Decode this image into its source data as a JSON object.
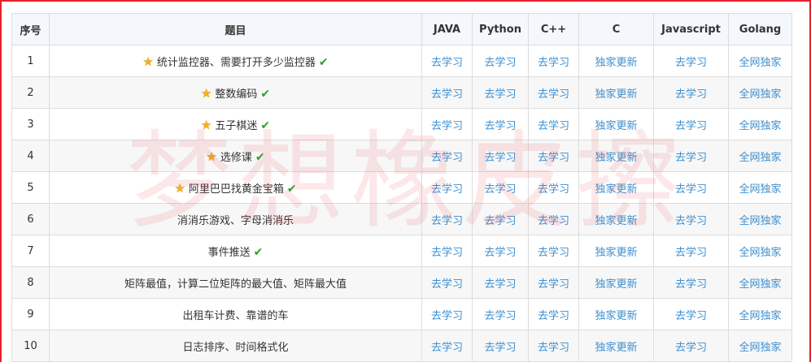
{
  "columns": {
    "index": "序号",
    "title": "题目",
    "java": "JAVA",
    "python": "Python",
    "cpp": "C++",
    "c": "C",
    "javascript": "Javascript",
    "golang": "Golang"
  },
  "icons": {
    "star": "star-icon",
    "check": "check-icon"
  },
  "colors": {
    "link": "#3d8fcf",
    "star": "#f2b01e",
    "check": "#2f9e28",
    "border": "#e8202a",
    "watermark": "#e83c46"
  },
  "watermark": "梦想橡皮擦",
  "rows": [
    {
      "index": "1",
      "title": "统计监控器、需要打开多少监控器",
      "star": true,
      "check": true,
      "java": "去学习",
      "python": "去学习",
      "cpp": "去学习",
      "c": "独家更新",
      "javascript": "去学习",
      "golang": "全网独家"
    },
    {
      "index": "2",
      "title": "整数编码",
      "star": true,
      "check": true,
      "java": "去学习",
      "python": "去学习",
      "cpp": "去学习",
      "c": "独家更新",
      "javascript": "去学习",
      "golang": "全网独家"
    },
    {
      "index": "3",
      "title": "五子棋迷",
      "star": true,
      "check": true,
      "java": "去学习",
      "python": "去学习",
      "cpp": "去学习",
      "c": "独家更新",
      "javascript": "去学习",
      "golang": "全网独家"
    },
    {
      "index": "4",
      "title": "选修课",
      "star": true,
      "check": true,
      "java": "去学习",
      "python": "去学习",
      "cpp": "去学习",
      "c": "独家更新",
      "javascript": "去学习",
      "golang": "全网独家"
    },
    {
      "index": "5",
      "title": "阿里巴巴找黄金宝箱",
      "star": true,
      "check": true,
      "java": "去学习",
      "python": "去学习",
      "cpp": "去学习",
      "c": "独家更新",
      "javascript": "去学习",
      "golang": "全网独家"
    },
    {
      "index": "6",
      "title": "消消乐游戏、字母消消乐",
      "star": false,
      "check": false,
      "java": "去学习",
      "python": "去学习",
      "cpp": "去学习",
      "c": "独家更新",
      "javascript": "去学习",
      "golang": "全网独家"
    },
    {
      "index": "7",
      "title": "事件推送",
      "star": false,
      "check": true,
      "java": "去学习",
      "python": "去学习",
      "cpp": "去学习",
      "c": "独家更新",
      "javascript": "去学习",
      "golang": "全网独家"
    },
    {
      "index": "8",
      "title": "矩阵最值，计算二位矩阵的最大值、矩阵最大值",
      "star": false,
      "check": false,
      "java": "去学习",
      "python": "去学习",
      "cpp": "去学习",
      "c": "独家更新",
      "javascript": "去学习",
      "golang": "全网独家"
    },
    {
      "index": "9",
      "title": "出租车计费、靠谱的车",
      "star": false,
      "check": false,
      "java": "去学习",
      "python": "去学习",
      "cpp": "去学习",
      "c": "独家更新",
      "javascript": "去学习",
      "golang": "全网独家"
    },
    {
      "index": "10",
      "title": "日志排序、时间格式化",
      "star": false,
      "check": false,
      "java": "去学习",
      "python": "去学习",
      "cpp": "去学习",
      "c": "独家更新",
      "javascript": "去学习",
      "golang": "全网独家"
    }
  ]
}
